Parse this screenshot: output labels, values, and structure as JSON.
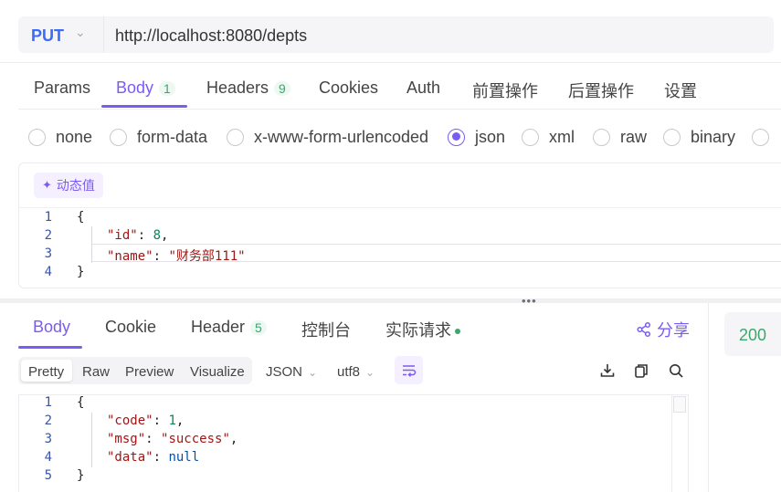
{
  "request": {
    "method": "PUT",
    "url": "http://localhost:8080/depts"
  },
  "request_tabs": [
    {
      "label": "Params"
    },
    {
      "label": "Body",
      "badge": "1"
    },
    {
      "label": "Headers",
      "badge": "9"
    },
    {
      "label": "Cookies"
    },
    {
      "label": "Auth"
    },
    {
      "label": "前置操作"
    },
    {
      "label": "后置操作"
    },
    {
      "label": "设置"
    }
  ],
  "body_types": [
    {
      "label": "none",
      "checked": false
    },
    {
      "label": "form-data",
      "checked": false
    },
    {
      "label": "x-www-form-urlencoded",
      "checked": false
    },
    {
      "label": "json",
      "checked": true
    },
    {
      "label": "xml",
      "checked": false
    },
    {
      "label": "raw",
      "checked": false
    },
    {
      "label": "binary",
      "checked": false
    }
  ],
  "dynamic_value_label": "动态值",
  "request_body": {
    "line_numbers": [
      "1",
      "2",
      "3",
      "4"
    ],
    "open_brace": "{",
    "close_brace": "}",
    "id_key": "\"id\"",
    "id_value": "8",
    "name_key": "\"name\"",
    "name_value": "\"财务部111\""
  },
  "response_tabs": [
    {
      "label": "Body"
    },
    {
      "label": "Cookie"
    },
    {
      "label": "Header",
      "badge": "5"
    },
    {
      "label": "控制台"
    },
    {
      "label": "实际请求"
    }
  ],
  "share_label": "分享",
  "view_modes": [
    "Pretty",
    "Raw",
    "Preview",
    "Visualize"
  ],
  "format_select": "JSON",
  "encoding_select": "utf8",
  "response_body": {
    "line_numbers": [
      "1",
      "2",
      "3",
      "4",
      "5"
    ],
    "open_brace": "{",
    "close_brace": "}",
    "code_key": "\"code\"",
    "code_value": "1",
    "msg_key": "\"msg\"",
    "msg_value": "\"success\"",
    "data_key": "\"data\"",
    "data_value": "null"
  },
  "status_code": "200",
  "colors": {
    "accent": "#7b5cf0",
    "method": "#3b6cf6",
    "success": "#3aa76d"
  }
}
